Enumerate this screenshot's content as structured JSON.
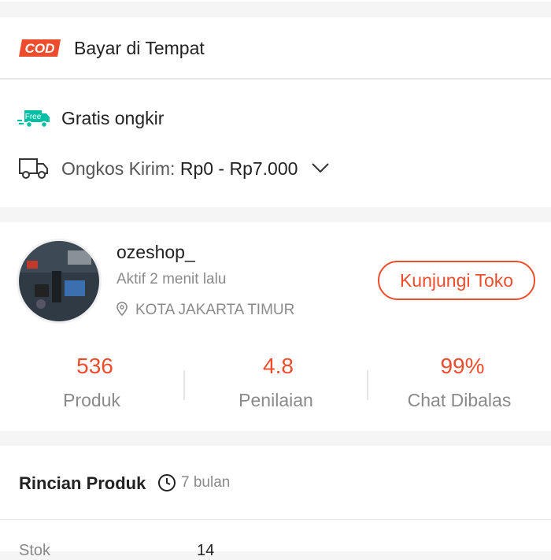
{
  "payment": {
    "cod_badge": "COD",
    "cod_label": "Bayar di Tempat"
  },
  "shipping": {
    "free_badge": "Free",
    "free_label": "Gratis ongkir",
    "cost_label": "Ongkos Kirim:",
    "cost_value": "Rp0 - Rp7.000"
  },
  "shop": {
    "name": "ozeshop_",
    "active": "Aktif 2 menit lalu",
    "location": "KOTA JAKARTA TIMUR",
    "visit_button": "Kunjungi Toko",
    "stats": [
      {
        "value": "536",
        "label": "Produk"
      },
      {
        "value": "4.8",
        "label": "Penilaian"
      },
      {
        "value": "99%",
        "label": "Chat Dibalas"
      }
    ]
  },
  "details": {
    "title": "Rincian Produk",
    "age": "7 bulan",
    "rows": [
      {
        "label": "Stok",
        "value": "14"
      }
    ]
  },
  "colors": {
    "accent": "#ee4d2d",
    "free_shipping": "#00bfa5"
  }
}
